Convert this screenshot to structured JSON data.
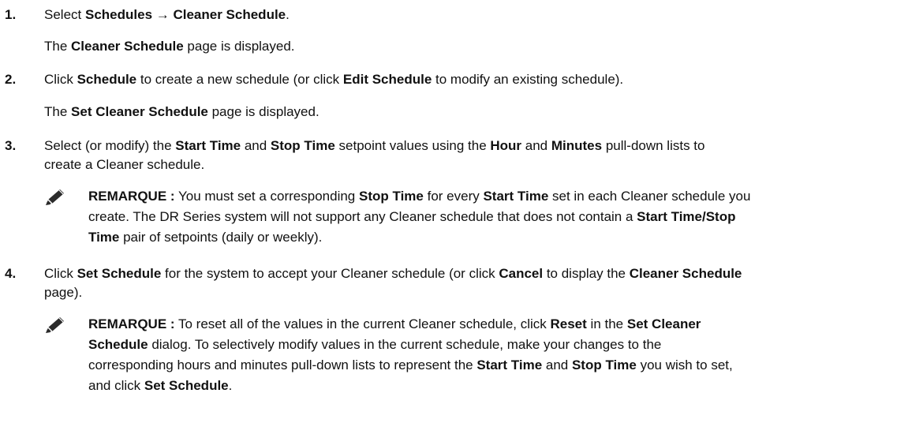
{
  "steps": [
    {
      "num": "1.",
      "line": [
        "Select ",
        "Schedules → Cleaner Schedule",
        "."
      ],
      "result": [
        "The ",
        "Cleaner Schedule",
        " page is displayed."
      ]
    },
    {
      "num": "2.",
      "line": [
        "Click ",
        "Schedule",
        " to create a new schedule (or click ",
        "Edit Schedule",
        " to modify an existing schedule)."
      ],
      "result": [
        "The ",
        "Set Cleaner Schedule",
        " page is displayed."
      ]
    },
    {
      "num": "3.",
      "line": [
        "Select (or modify) the ",
        "Start Time",
        " and ",
        "Stop Time",
        " setpoint values using the ",
        "Hour",
        " and ",
        "Minutes",
        " pull-down lists to"
      ],
      "line2": "create a Cleaner schedule.",
      "note": {
        "label": "REMARQUE :",
        "l1": [
          " You must set a corresponding ",
          "Stop Time",
          " for every ",
          "Start Time",
          " set in each Cleaner schedule you"
        ],
        "l2": [
          "create. The DR Series system will not support any Cleaner schedule that does not contain a ",
          "Start Time/Stop"
        ],
        "l3": [
          "Time",
          " pair of setpoints (daily or weekly)."
        ]
      }
    },
    {
      "num": "4.",
      "line": [
        "Click ",
        "Set Schedule",
        " for the system to accept your Cleaner schedule (or click ",
        "Cancel",
        " to display the ",
        "Cleaner Schedule"
      ],
      "line2": "page).",
      "note": {
        "label": "REMARQUE :",
        "l1": [
          " To reset all of the values in the current Cleaner schedule, click ",
          "Reset",
          " in the ",
          "Set Cleaner"
        ],
        "l2": [
          "Schedule",
          " dialog. To selectively modify values in the current schedule, make your changes to the"
        ],
        "l3": [
          "corresponding hours and minutes pull-down lists to represent the ",
          "Start Time",
          " and ",
          "Stop Time",
          " you wish to set,"
        ],
        "l4": [
          "and click ",
          "Set Schedule",
          "."
        ]
      }
    }
  ],
  "icons": {
    "note": "pencil-note-icon"
  }
}
